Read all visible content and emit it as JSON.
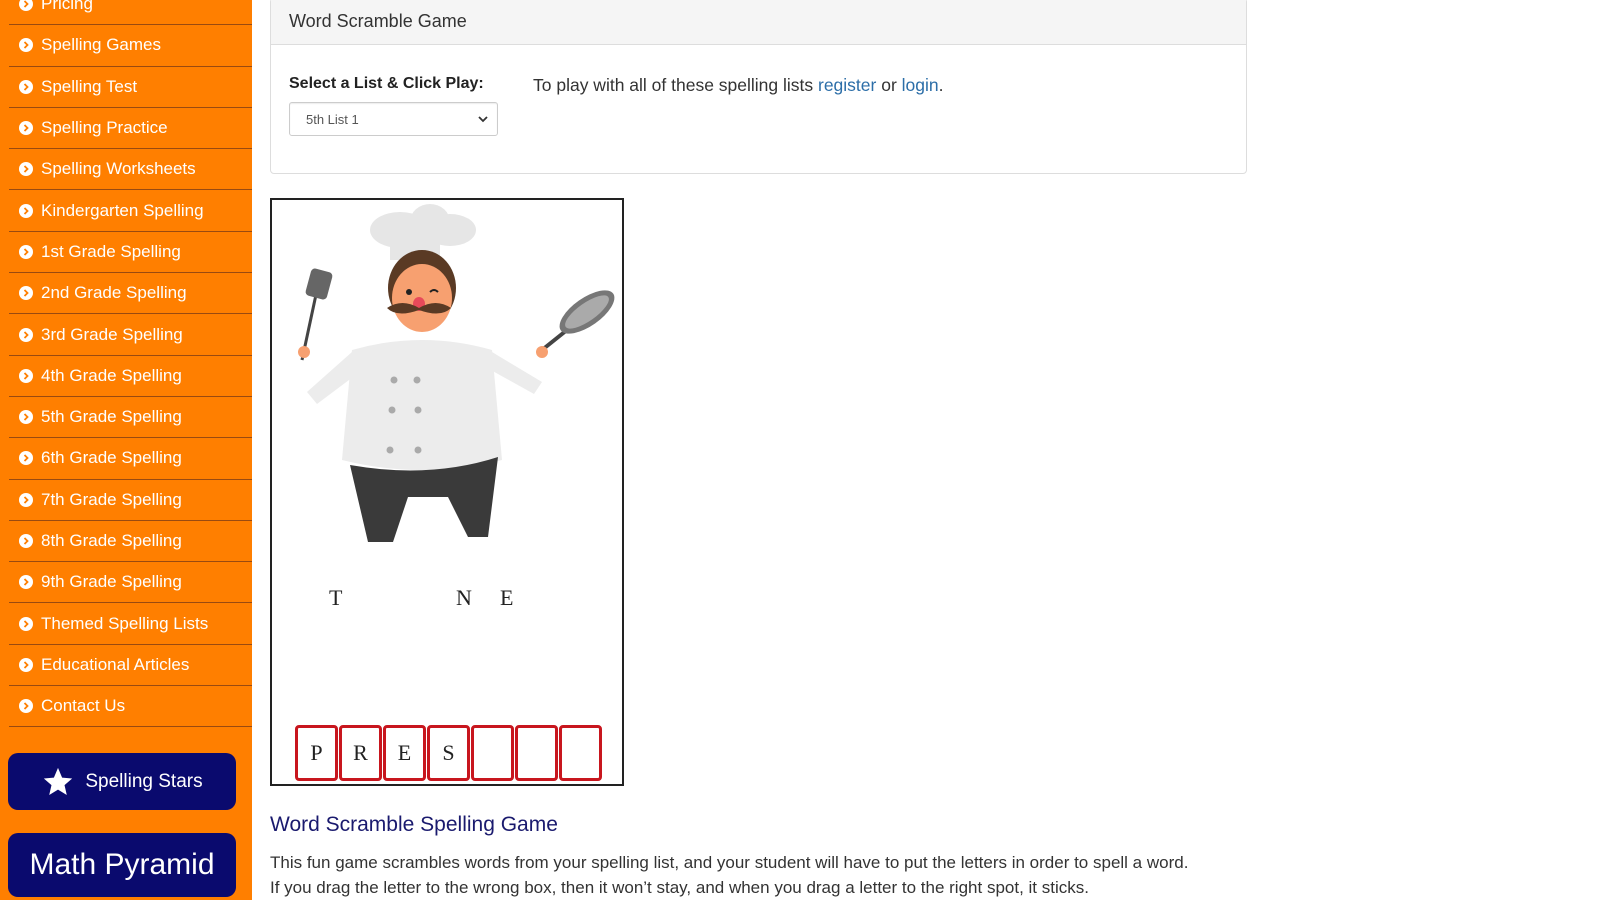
{
  "sidebar": {
    "items": [
      {
        "label": "Pricing"
      },
      {
        "label": "Spelling Games"
      },
      {
        "label": "Spelling Test"
      },
      {
        "label": "Spelling Practice"
      },
      {
        "label": "Spelling Worksheets"
      },
      {
        "label": "Kindergarten Spelling"
      },
      {
        "label": "1st Grade Spelling"
      },
      {
        "label": "2nd Grade Spelling"
      },
      {
        "label": "3rd Grade Spelling"
      },
      {
        "label": "4th Grade Spelling"
      },
      {
        "label": "5th Grade Spelling"
      },
      {
        "label": "6th Grade Spelling"
      },
      {
        "label": "7th Grade Spelling"
      },
      {
        "label": "8th Grade Spelling"
      },
      {
        "label": "9th Grade Spelling"
      },
      {
        "label": "Themed Spelling Lists"
      },
      {
        "label": "Educational Articles"
      },
      {
        "label": "Contact Us"
      }
    ],
    "spelling_stars_label": "Spelling Stars",
    "math_pyramid_label": "Math Pyramid"
  },
  "panel": {
    "title": "Word Scramble Game",
    "select_label": "Select a List & Click Play:",
    "selected_list": "5th List 1",
    "register_prefix": "To play with all of these spelling lists ",
    "register_link": "register",
    "or_text": " or ",
    "login_link": "login",
    "suffix": "."
  },
  "game": {
    "scrambled_letters": [
      "T",
      "N",
      "E"
    ],
    "slots": [
      "P",
      "R",
      "E",
      "S",
      "",
      "",
      ""
    ]
  },
  "description": {
    "title": "Word Scramble Spelling Game",
    "line1": "This fun game scrambles words from your spelling list, and your student will have to put the letters in order to spell a word.",
    "line2": "If you drag the letter to the wrong box, then it won’t stay, and when you drag a letter to the right spot, it sticks."
  },
  "colors": {
    "sidebar_bg": "#ff7f00",
    "button_navy": "#0a0a6e",
    "link_blue": "#2c6ea8",
    "slot_red": "#c8161e"
  }
}
